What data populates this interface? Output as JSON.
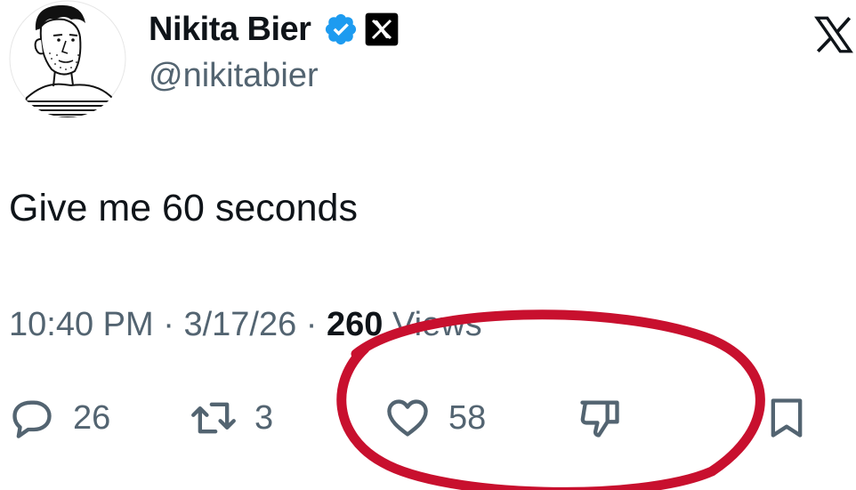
{
  "author": {
    "display_name": "Nikita Bier",
    "handle": "@nikitabier"
  },
  "tweet": {
    "text": "Give me 60 seconds"
  },
  "meta": {
    "time": "10:40 PM",
    "date": "3/17/26",
    "views_count": "260",
    "views_label": "Views",
    "separator": "·"
  },
  "actions": {
    "replies": "26",
    "reposts": "3",
    "likes": "58"
  },
  "icons": [
    "avatar",
    "verified-badge-icon",
    "x-badge-icon",
    "x-logo-icon",
    "reply-icon",
    "repost-icon",
    "like-icon",
    "dislike-icon",
    "bookmark-icon"
  ],
  "colors": {
    "text": "#0f1419",
    "secondary": "#536471",
    "verified": "#1d9bf0",
    "annotation": "#c8102e"
  }
}
